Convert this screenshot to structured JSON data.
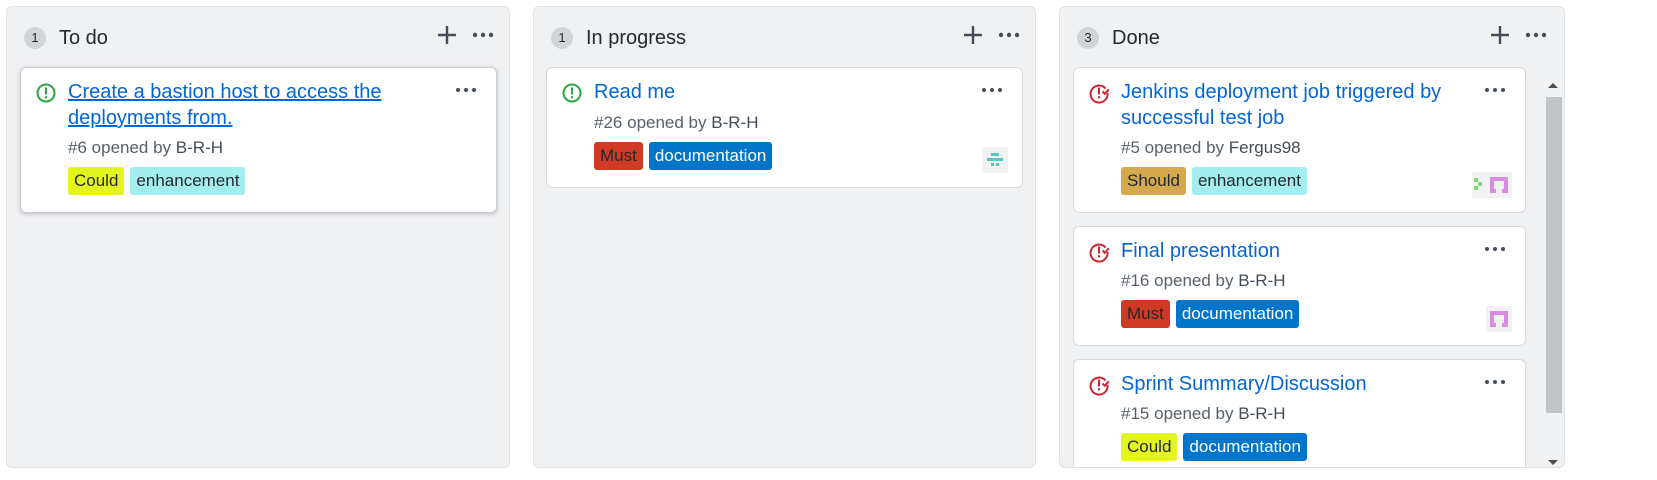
{
  "columns": [
    {
      "count": "1",
      "title": "To do",
      "cards": [
        {
          "status": "open",
          "title": "Create a bastion host to access the deployments from.",
          "number": "#6",
          "opened_by": "opened by",
          "author": "B-R-H",
          "labels": [
            {
              "text": "Could",
              "bg": "#e4f51d",
              "fg": "#24292e"
            },
            {
              "text": "enhancement",
              "bg": "#a2eeef",
              "fg": "#24292e"
            }
          ]
        }
      ]
    },
    {
      "count": "1",
      "title": "In progress",
      "cards": [
        {
          "status": "open",
          "title": "Read me",
          "number": "#26",
          "opened_by": "opened by",
          "author": "B-R-H",
          "labels": [
            {
              "text": "Must",
              "bg": "#d03a24",
              "fg": "#24292e"
            },
            {
              "text": "documentation",
              "bg": "#0075ca",
              "fg": "#ffffff"
            }
          ]
        }
      ]
    },
    {
      "count": "3",
      "title": "Done",
      "cards": [
        {
          "status": "closed",
          "title": "Jenkins deployment job triggered by successful test job",
          "number": "#5",
          "opened_by": "opened by",
          "author": "Fergus98",
          "labels": [
            {
              "text": "Should",
              "bg": "#d4a94e",
              "fg": "#24292e"
            },
            {
              "text": "enhancement",
              "bg": "#a2eeef",
              "fg": "#24292e"
            }
          ]
        },
        {
          "status": "closed",
          "title": "Final presentation",
          "number": "#16",
          "opened_by": "opened by",
          "author": "B-R-H",
          "labels": [
            {
              "text": "Must",
              "bg": "#d03a24",
              "fg": "#24292e"
            },
            {
              "text": "documentation",
              "bg": "#0075ca",
              "fg": "#ffffff"
            }
          ]
        },
        {
          "status": "closed",
          "title": "Sprint Summary/Discussion",
          "number": "#15",
          "opened_by": "opened by",
          "author": "B-R-H",
          "labels": [
            {
              "text": "Could",
              "bg": "#e4f51d",
              "fg": "#24292e"
            },
            {
              "text": "documentation",
              "bg": "#0075ca",
              "fg": "#ffffff"
            }
          ]
        }
      ]
    }
  ],
  "colors": {
    "open_icon": "#28a745",
    "closed_icon": "#cb2431",
    "link": "#0366d6",
    "column_bg": "#f0f1f3"
  },
  "icons": {
    "add": "plus-icon",
    "more": "kebab-horizontal-icon",
    "open": "issue-opened-icon",
    "closed": "issue-closed-icon"
  }
}
